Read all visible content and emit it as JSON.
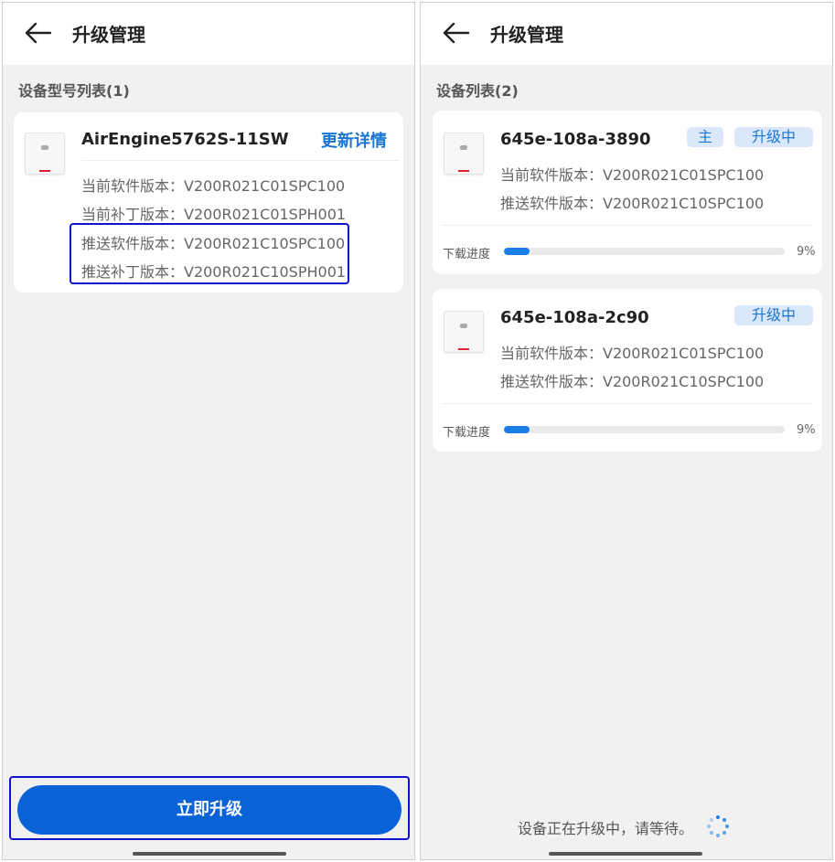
{
  "left": {
    "header": {
      "title": "升级管理",
      "back_icon": "arrow-left-icon"
    },
    "section_label": "设备型号列表(1)",
    "device": {
      "name": "AirEngine5762S-11SW",
      "detail_link": "更新详情",
      "current_software": "当前软件版本：V200R021C01SPC100",
      "current_patch": "当前补丁版本：V200R021C01SPH001",
      "push_software": "推送软件版本：V200R021C10SPC100",
      "push_patch": "推送补丁版本：V200R021C10SPH001"
    },
    "upgrade_button": "立即升级"
  },
  "right": {
    "header": {
      "title": "升级管理",
      "back_icon": "arrow-left-icon"
    },
    "section_label": "设备列表(2)",
    "devices": [
      {
        "name": "645e-108a-3890",
        "badges": [
          "主",
          "升级中"
        ],
        "current_software": "当前软件版本：V200R021C01SPC100",
        "push_software": "推送软件版本：V200R021C10SPC100",
        "download_label": "下载进度",
        "progress_percent": 9,
        "progress_text": "9%"
      },
      {
        "name": "645e-108a-2c90",
        "badges": [
          "升级中"
        ],
        "current_software": "当前软件版本：V200R021C01SPC100",
        "push_software": "推送软件版本：V200R021C10SPC100",
        "download_label": "下载进度",
        "progress_percent": 9,
        "progress_text": "9%"
      }
    ],
    "waiting_text": "设备正在升级中，请等待。"
  },
  "colors": {
    "accent": "#1976d2",
    "button": "#0a63d6",
    "highlight_border": "#1212cc",
    "badge_bg": "#dbe8fb"
  }
}
